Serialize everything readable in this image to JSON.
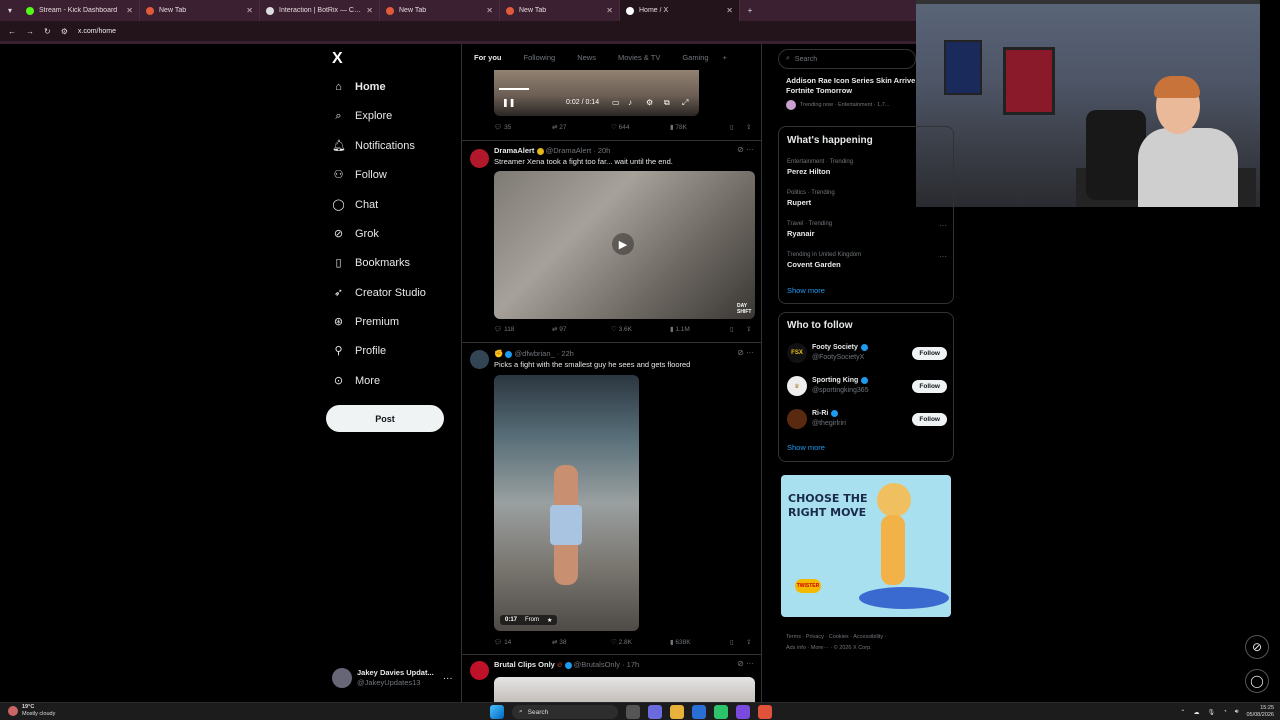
{
  "browser": {
    "tabs": [
      {
        "title": "Stream - Kick Dashboard",
        "fav_color": "#53fc18"
      },
      {
        "title": "New Tab",
        "fav_color": "#e05b3a"
      },
      {
        "title": "Interaction | BotRix — Cloud Stre",
        "fav_color": "#dddddd"
      },
      {
        "title": "New Tab",
        "fav_color": "#e05b3a"
      },
      {
        "title": "New Tab",
        "fav_color": "#e05b3a"
      },
      {
        "title": "Home / X",
        "fav_color": "#ffffff"
      }
    ],
    "url": "x.com/home"
  },
  "nav": {
    "logo": "X",
    "items": [
      {
        "label": "Home",
        "icon": "home-icon",
        "glyph": "⌂"
      },
      {
        "label": "Explore",
        "icon": "search-icon",
        "glyph": "⌕"
      },
      {
        "label": "Notifications",
        "icon": "bell-icon",
        "glyph": "🔔︎"
      },
      {
        "label": "Follow",
        "icon": "follow-icon",
        "glyph": "⚇"
      },
      {
        "label": "Chat",
        "icon": "chat-icon",
        "glyph": "◯"
      },
      {
        "label": "Grok",
        "icon": "grok-icon",
        "glyph": "⊘"
      },
      {
        "label": "Bookmarks",
        "icon": "bookmark-icon",
        "glyph": "▯"
      },
      {
        "label": "Creator Studio",
        "icon": "rocket-icon",
        "glyph": "➶"
      },
      {
        "label": "Premium",
        "icon": "premium-icon",
        "glyph": "⊛"
      },
      {
        "label": "Profile",
        "icon": "profile-icon",
        "glyph": "⚲"
      },
      {
        "label": "More",
        "icon": "more-circle-icon",
        "glyph": "⊙"
      }
    ],
    "post_label": "Post",
    "account": {
      "name": "Jakey Davies Updat...",
      "handle": "@JakeyUpdates13"
    }
  },
  "timeline": {
    "tabs": [
      "For you",
      "Following",
      "News",
      "Movies & TV",
      "Gaming"
    ],
    "video_controls": {
      "time": "0:02 / 0:14"
    },
    "post0_actions": {
      "replies": "35",
      "reposts": "27",
      "likes": "644",
      "views": "78K"
    },
    "posts": [
      {
        "name": "DramaAlert",
        "handle": "@DramaAlert · 20h",
        "text": "Streamer Xena took a fight too far... wait until the end.",
        "watermark": "DAY SHIFT",
        "replies": "118",
        "reposts": "97",
        "likes": "3.6K",
        "views": "1.1M"
      },
      {
        "name": "",
        "handle": "@dfwbrian_ · 22h",
        "text": "Picks a fight with the smallest guy he sees and gets floored",
        "video_time": "0:17",
        "video_from": "From",
        "replies": "14",
        "reposts": "38",
        "likes": "2.8K",
        "views": "638K"
      },
      {
        "name": "Brutal Clips Only",
        "handle": "@BrutalsOnly · 17h"
      }
    ]
  },
  "right": {
    "search_placeholder": "Search",
    "top_trend": {
      "title": "Addison Rae Icon Series Skin Arrive Fortnite Tomorrow",
      "meta": "Trending now · Entertainment · 1,7..."
    },
    "whats_happening": {
      "title": "What's happening",
      "trends": [
        {
          "cat": "Entertainment · Trending",
          "name": "Perez Hilton"
        },
        {
          "cat": "Politics · Trending",
          "name": "Rupert"
        },
        {
          "cat": "Travel · Trending",
          "name": "Ryanair"
        },
        {
          "cat": "Trending in United Kingdom",
          "name": "Covent Garden"
        }
      ],
      "show_more": "Show more"
    },
    "who_to_follow": {
      "title": "Who to follow",
      "accounts": [
        {
          "name": "Footy Society",
          "handle": "@FootySocietyX",
          "badge": "FSX",
          "bg": "#111111",
          "fg": "#f0c419"
        },
        {
          "name": "Sporting King",
          "handle": "@sportingking365",
          "badge": "♛",
          "bg": "#eeeeee",
          "fg": "#b08a2a"
        },
        {
          "name": "Ri-Ri",
          "handle": "@thegirlriri",
          "badge": "",
          "bg": "#5a2a10",
          "fg": "#ffffff"
        }
      ],
      "follow_label": "Follow",
      "show_more": "Show more"
    },
    "ad": {
      "headline": "CHOOSE THE RIGHT MOVE",
      "logo": "TWISTER"
    },
    "footer": {
      "line1": "Terms · Privacy · Cookies · Accessibility ·",
      "line2": "Ads info · More··· · © 2026 X Corp."
    }
  },
  "taskbar": {
    "weather_temp": "19°C",
    "weather_desc": "Mostly cloudy",
    "search": "Search",
    "time": "15:25",
    "date": "05/08/2026"
  }
}
